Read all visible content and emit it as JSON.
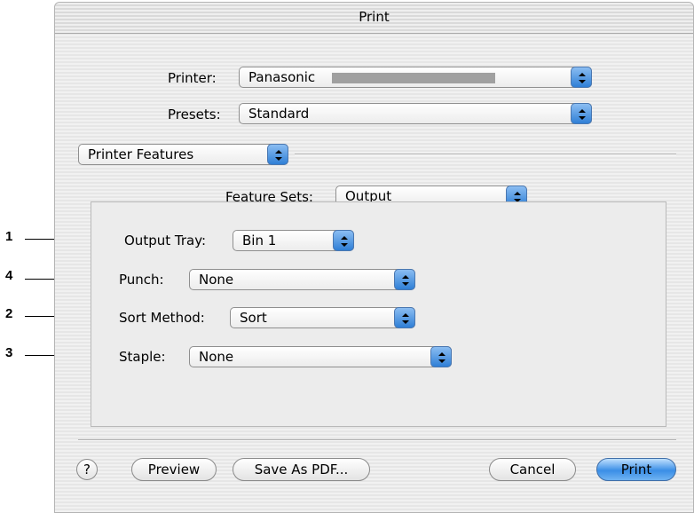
{
  "window": {
    "title": "Print"
  },
  "printer": {
    "label": "Printer:",
    "value": "Panasonic"
  },
  "presets": {
    "label": "Presets:",
    "value": "Standard"
  },
  "pane": {
    "value": "Printer Features"
  },
  "feature_sets": {
    "label": "Feature Sets:",
    "value": "Output"
  },
  "features": [
    {
      "callout": "1",
      "label": "Output Tray:",
      "value": "Bin 1"
    },
    {
      "callout": "4",
      "label": "Punch:",
      "value": "None"
    },
    {
      "callout": "2",
      "label": "Sort Method:",
      "value": "Sort"
    },
    {
      "callout": "3",
      "label": "Staple:",
      "value": "None"
    }
  ],
  "buttons": {
    "help": "?",
    "preview": "Preview",
    "save_as_pdf": "Save As PDF...",
    "cancel": "Cancel",
    "print": "Print"
  },
  "colors": {
    "accent": "#3a8ee6",
    "window_bg": "#ececec"
  }
}
